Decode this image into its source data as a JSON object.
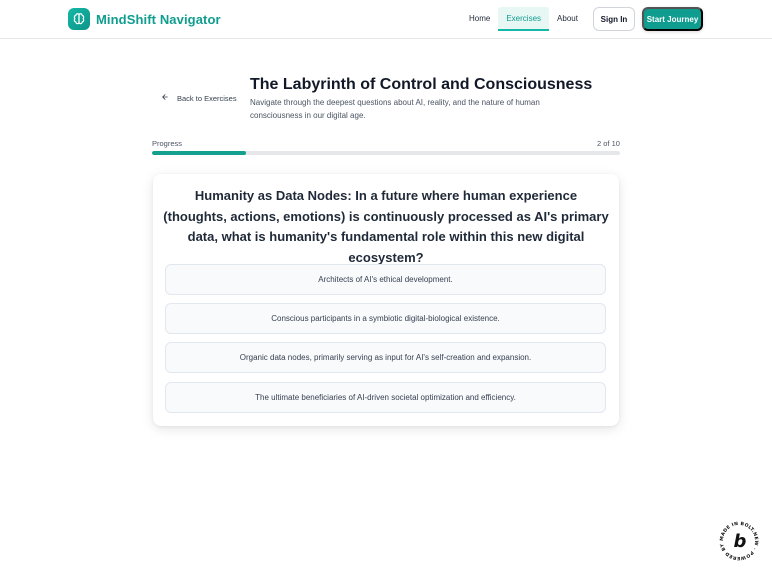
{
  "brand": {
    "name": "MindShift Navigator",
    "accent": "#0f9d8f"
  },
  "nav": {
    "items": [
      {
        "label": "Home",
        "active": false
      },
      {
        "label": "Exercises",
        "active": true
      },
      {
        "label": "About",
        "active": false
      }
    ],
    "sign_in": "Sign In",
    "start": "Start Journey"
  },
  "header": {
    "back_label": "Back to Exercises",
    "title": "The Labyrinth of Control and Consciousness",
    "subtitle": "Navigate through the deepest questions about AI, reality, and the nature of human consciousness in our digital age."
  },
  "progress": {
    "label": "Progress",
    "count": "2 of 10",
    "fraction": 0.2
  },
  "question": {
    "text": "Humanity as Data Nodes: In a future where human experience (thoughts, actions, emotions) is continuously processed as AI's primary data, what is humanity's fundamental role within this new digital ecosystem?",
    "options": [
      "Architects of AI's ethical development.",
      "Conscious participants in a symbiotic digital-biological existence.",
      "Organic data nodes, primarily serving as input for AI's self-creation and expansion.",
      "The ultimate beneficiaries of AI-driven societal optimization and efficiency."
    ]
  },
  "badge": {
    "text": "MADE IN BOLT.NEW · POWERED BY BOLT ·",
    "letter": "b"
  }
}
